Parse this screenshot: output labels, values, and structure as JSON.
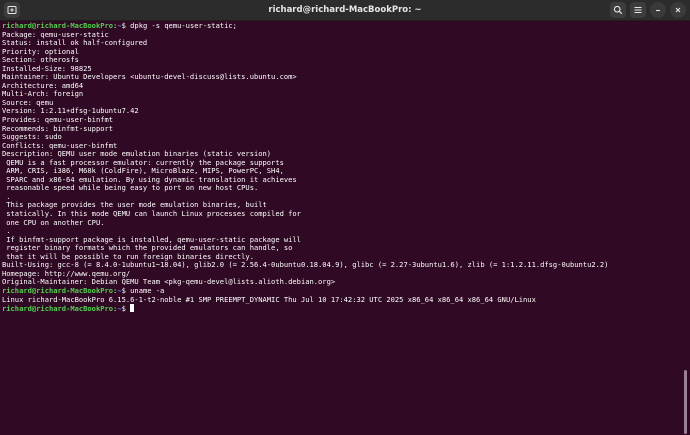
{
  "window": {
    "title": "richard@richard-MacBookPro: ~"
  },
  "titlebar_buttons": {
    "new_tab_icon": "new-tab-icon",
    "search_icon": "search-icon",
    "menu_icon": "hamburger-menu-icon",
    "minimize_icon": "minimize-icon",
    "close_icon": "close-icon"
  },
  "colors": {
    "background": "#300a24",
    "prompt_user": "#4fd14b",
    "prompt_path": "#5d8ad6",
    "text": "#ffffff"
  },
  "prompt": {
    "user_host": "richard@richard-MacBookPro",
    "separator": ":",
    "path": "~",
    "symbol": "$ "
  },
  "commands": [
    "dpkg -s qemu-user-static;",
    "uname -a"
  ],
  "output1": [
    "Package: qemu-user-static",
    "Status: install ok half-configured",
    "Priority: optional",
    "Section: otherosfs",
    "Installed-Size: 98825",
    "Maintainer: Ubuntu Developers <ubuntu-devel-discuss@lists.ubuntu.com>",
    "Architecture: amd64",
    "Multi-Arch: foreign",
    "Source: qemu",
    "Version: 1:2.11+dfsg-1ubuntu7.42",
    "Provides: qemu-user-binfmt",
    "Recommends: binfmt-support",
    "Suggests: sudo",
    "Conflicts: qemu-user-binfmt",
    "Description: QEMU user mode emulation binaries (static version)",
    " QEMU is a fast processor emulator: currently the package supports",
    " ARM, CRIS, i386, M68k (ColdFire), MicroBlaze, MIPS, PowerPC, SH4,",
    " SPARC and x86-64 emulation. By using dynamic translation it achieves",
    " reasonable speed while being easy to port on new host CPUs.",
    " .",
    " This package provides the user mode emulation binaries, built",
    " statically. In this mode QEMU can launch Linux processes compiled for",
    " one CPU on another CPU.",
    " .",
    " If binfmt-support package is installed, qemu-user-static package will",
    " register binary formats which the provided emulators can handle, so",
    " that it will be possible to run foreign binaries directly.",
    "Built-Using: gcc-8 (= 8.4.0-1ubuntu1~18.04), glib2.0 (= 2.56.4-0ubuntu0.18.04.9), glibc (= 2.27-3ubuntu1.6), zlib (= 1:1.2.11.dfsg-0ubuntu2.2)",
    "Homepage: http://www.qemu.org/",
    "Original-Maintainer: Debian QEMU Team <pkg-qemu-devel@lists.alioth.debian.org>"
  ],
  "output2": [
    "Linux richard-MacBookPro 6.15.6-1-t2-noble #1 SMP PREEMPT_DYNAMIC Thu Jul 10 17:42:32 UTC 2025 x86_64 x86_64 x86_64 GNU/Linux"
  ]
}
